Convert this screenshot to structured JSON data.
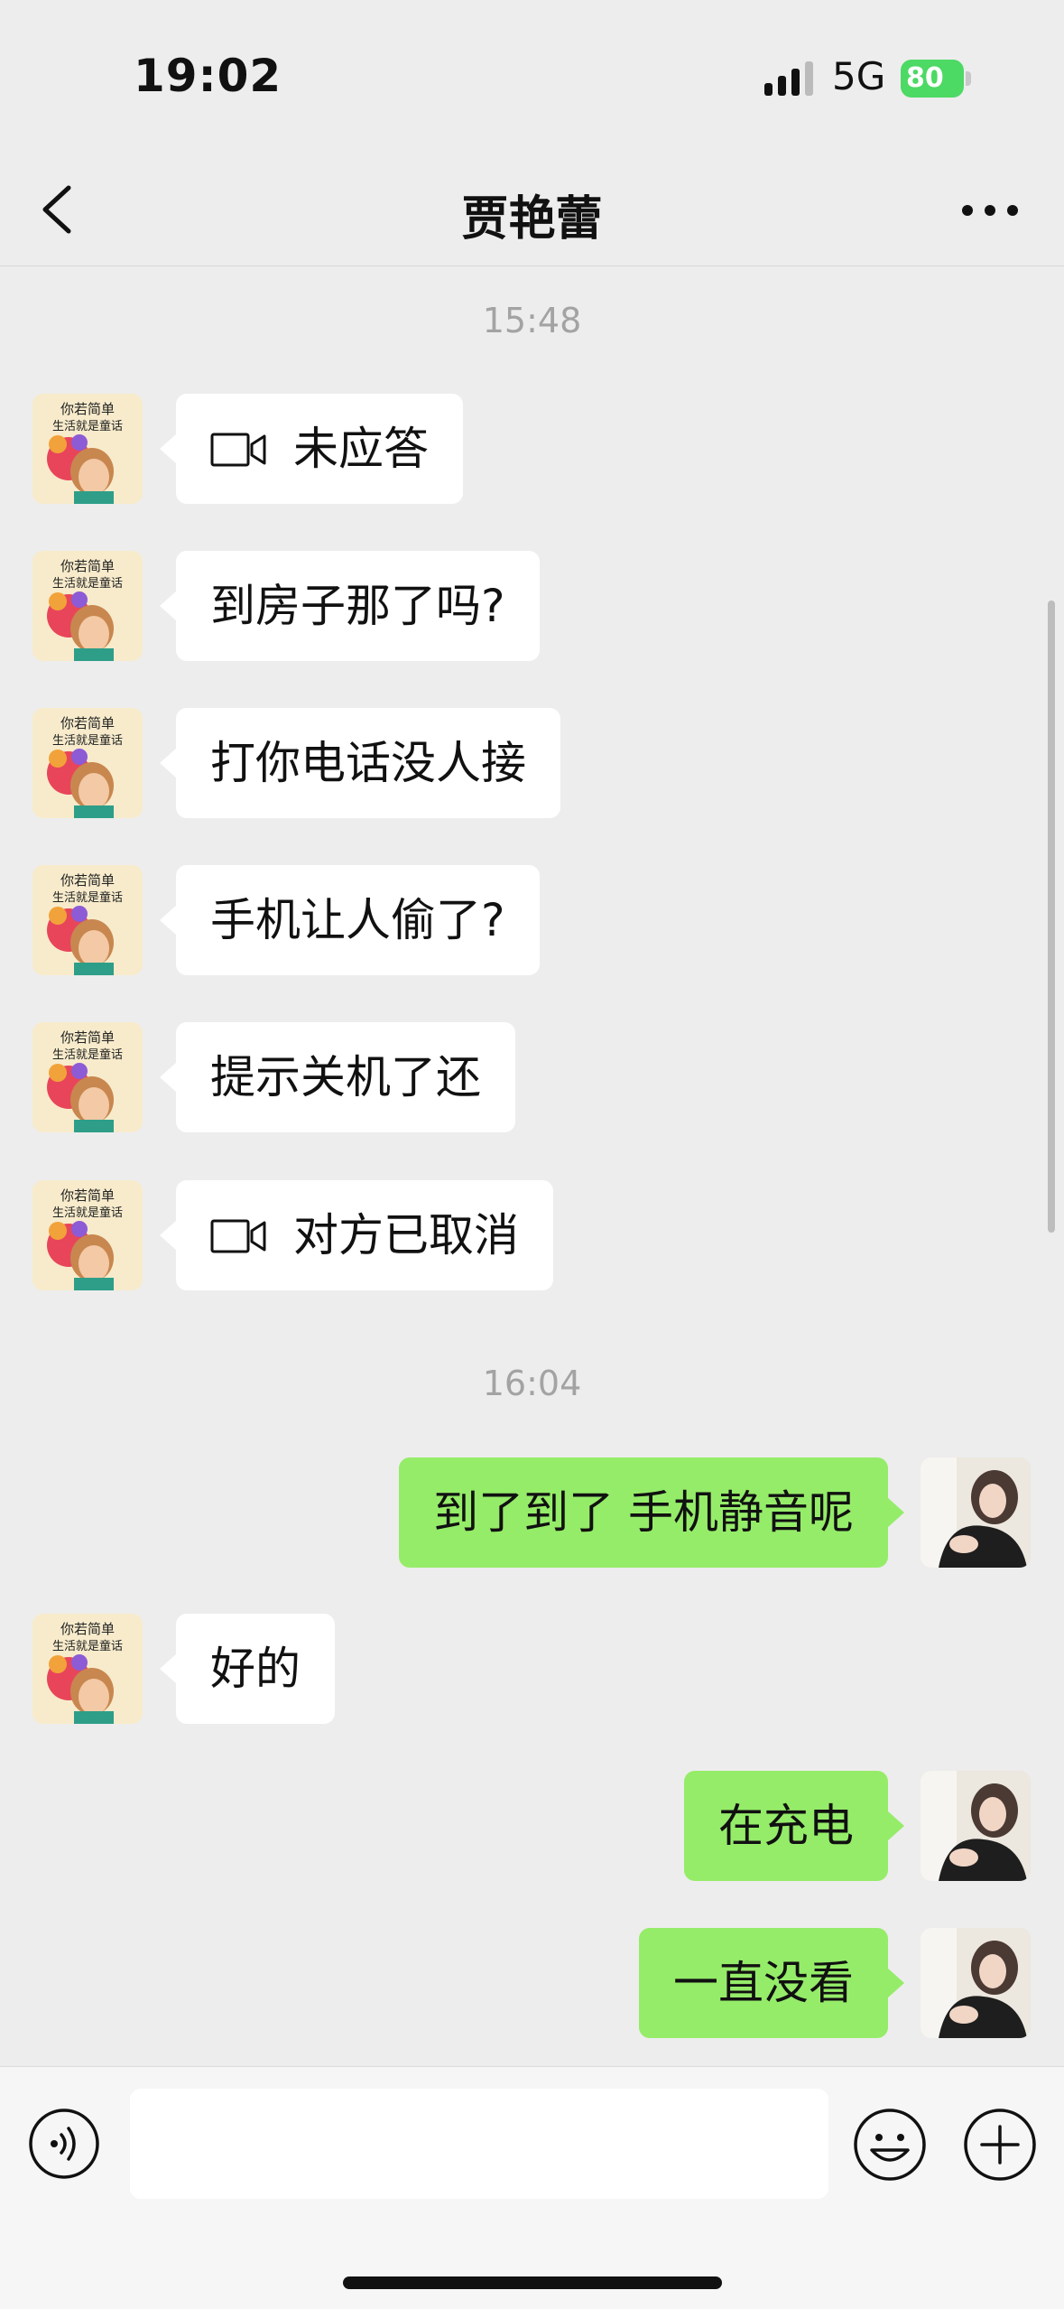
{
  "status_bar": {
    "time": "19:02",
    "network": "5G",
    "battery": "80"
  },
  "nav": {
    "title": "贾艳蕾"
  },
  "messages": [
    {
      "type": "timestamp",
      "text": "15:48"
    },
    {
      "type": "in",
      "text": "未应答",
      "icon": "video-call-icon"
    },
    {
      "type": "in",
      "text": "到房子那了吗?"
    },
    {
      "type": "in",
      "text": "打你电话没人接"
    },
    {
      "type": "in",
      "text": "手机让人偷了?"
    },
    {
      "type": "in",
      "text": "提示关机了还"
    },
    {
      "type": "in",
      "text": "对方已取消",
      "icon": "video-call-icon"
    },
    {
      "type": "timestamp",
      "text": "16:04"
    },
    {
      "type": "out",
      "text": "到了到了 手机静音呢"
    },
    {
      "type": "in",
      "text": "好的"
    },
    {
      "type": "out",
      "text": "在充电"
    },
    {
      "type": "out",
      "text": "一直没看"
    }
  ],
  "avatar_left": {
    "caption": [
      "你若简单",
      "生活就是童话"
    ]
  },
  "colors": {
    "background": "#EDEDED",
    "incoming_bubble": "#FFFFFF",
    "outgoing_bubble": "#95EC69",
    "battery": "#4CD964",
    "timestamp": "#A3A3A3"
  },
  "input": {
    "value": "",
    "placeholder": ""
  }
}
